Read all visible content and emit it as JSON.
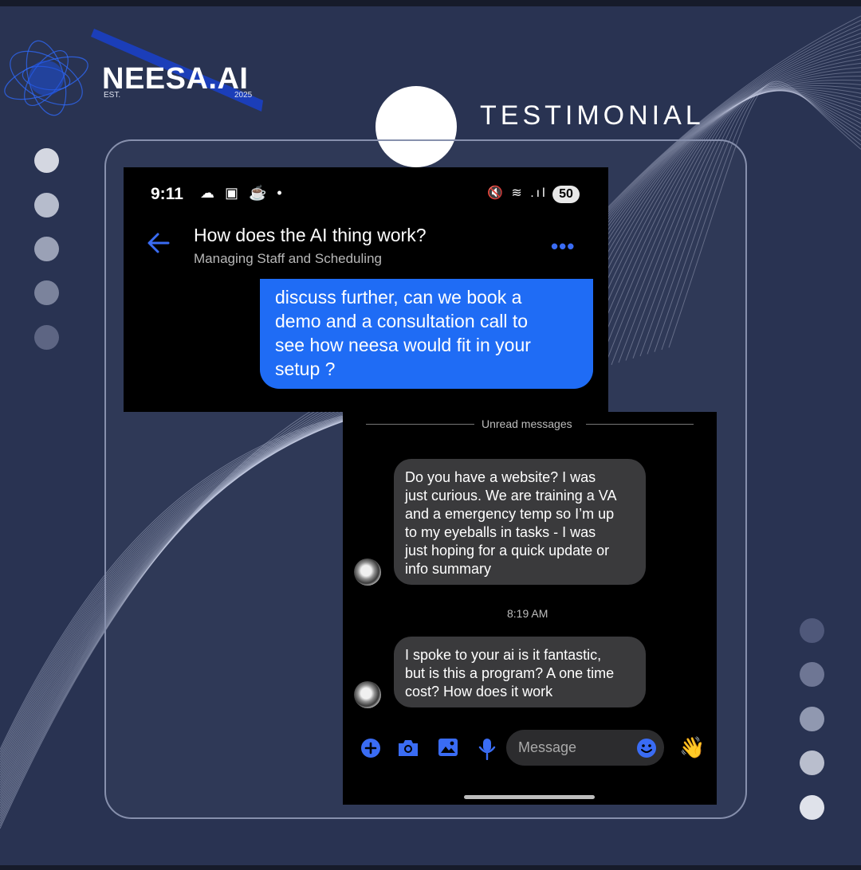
{
  "brand": {
    "name": "NEESA.AI",
    "est": "EST.",
    "year": "2025"
  },
  "heading": "TESTIMONIAL",
  "phone_top": {
    "time": "9:11",
    "status_left_icons": "☁ ▣ ☕ •",
    "status_right_icons": "🔇 ≋ .ıl",
    "battery": "50",
    "conversation_title": "How does the AI thing work?",
    "conversation_subtitle": "Managing Staff and Scheduling",
    "more_menu": "•••",
    "outgoing_lines": [
      "discuss further, can we book a",
      "demo and a consultation call to",
      "see how neesa would fit in your",
      "setup ?"
    ]
  },
  "phone_bottom": {
    "unread_label": "Unread messages",
    "incoming_1_lines": [
      "Do you have a website? I was",
      "just curious. We are training a VA",
      "and a emergency temp so I’m up",
      "to my eyeballs in tasks - I was",
      "just hoping for a quick update or",
      "info summary"
    ],
    "timestamp": "8:19 AM",
    "incoming_2_lines": [
      "I spoke to your ai is it fantastic,",
      "but is this a program? A one time",
      "cost? How does it work"
    ],
    "message_placeholder": "Message",
    "wave_emoji": "👋"
  },
  "colors": {
    "background": "#293352",
    "accent_blue": "#1f6cf5",
    "icon_blue": "#3a6cf4",
    "incoming_bubble": "#3a3a3c"
  }
}
